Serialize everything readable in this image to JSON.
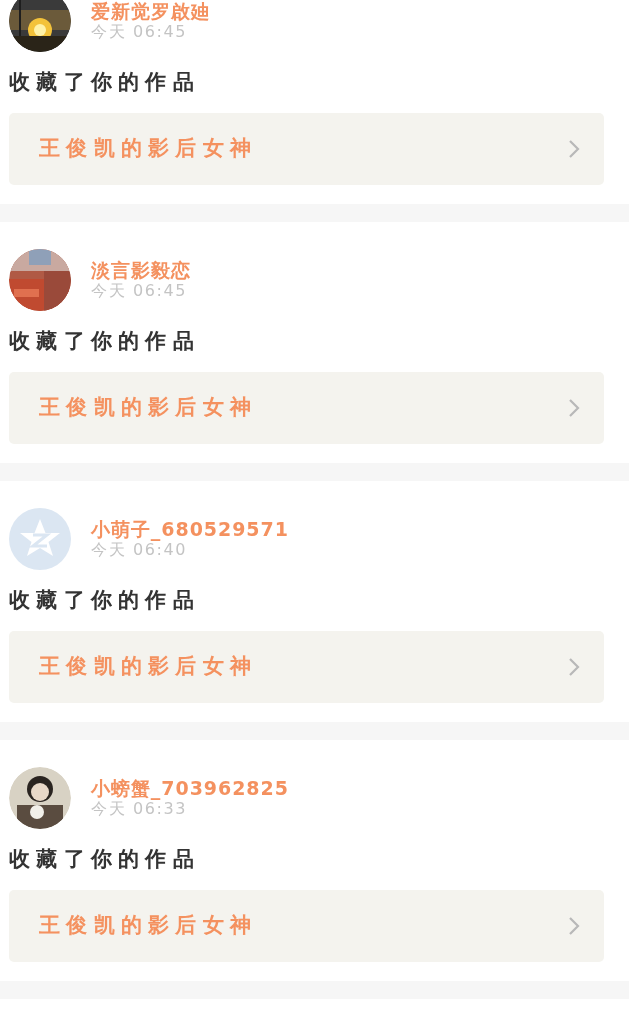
{
  "notifications": [
    {
      "name": "爱新觉罗啟廸",
      "time": "今天 06:45",
      "action": "收藏了你的作品",
      "work": "王俊凯的影后女神"
    },
    {
      "name": "淡言影毅恋",
      "time": "今天 06:45",
      "action": "收藏了你的作品",
      "work": "王俊凯的影后女神"
    },
    {
      "avatar": {
        "kind": "default"
      },
      "name": "小萌子_680529571",
      "time": "今天 06:40",
      "action": "收藏了你的作品",
      "work": "王俊凯的影后女神"
    },
    {
      "name": "小螃蟹_703962825",
      "time": "今天 06:33",
      "action": "收藏了你的作品",
      "work": "王俊凯的影后女神"
    }
  ]
}
